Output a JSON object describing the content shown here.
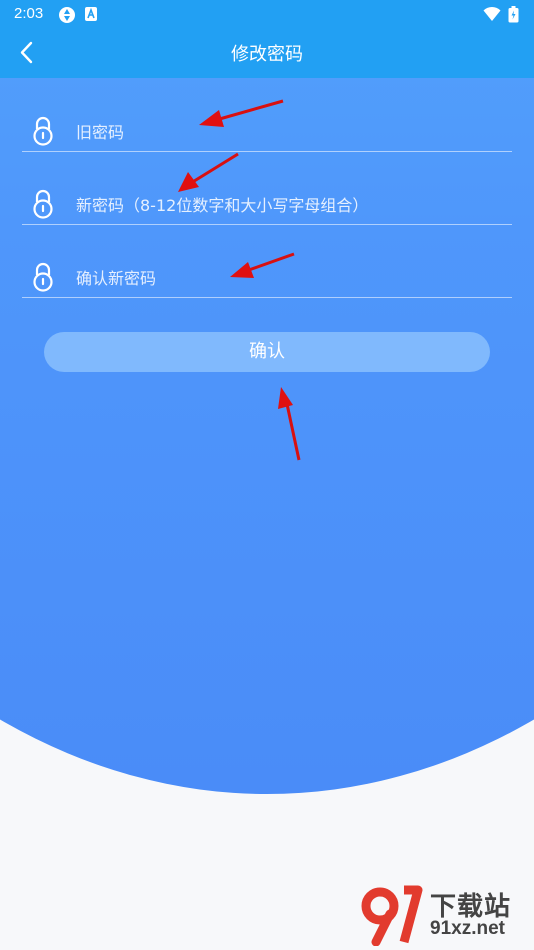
{
  "status_bar": {
    "time": "2:03"
  },
  "header": {
    "title": "修改密码",
    "back_icon": "chevron-left-icon"
  },
  "form": {
    "old_password": {
      "placeholder": "旧密码",
      "value": ""
    },
    "new_password": {
      "placeholder": "新密码（8-12位数字和大小写字母组合）",
      "value": ""
    },
    "confirm_password": {
      "placeholder": "确认新密码",
      "value": ""
    },
    "field_icon": "lock-icon",
    "submit_label": "确认"
  },
  "watermark": {
    "brand": "下载站",
    "domain": "91xz.net"
  },
  "colors": {
    "header_bg": "#22a0f3",
    "gradient_top": "#5ec4fb",
    "gradient_bottom": "#4a8cf8",
    "page_bg": "#f7f8fa",
    "annotation_arrow": "#e01010"
  }
}
